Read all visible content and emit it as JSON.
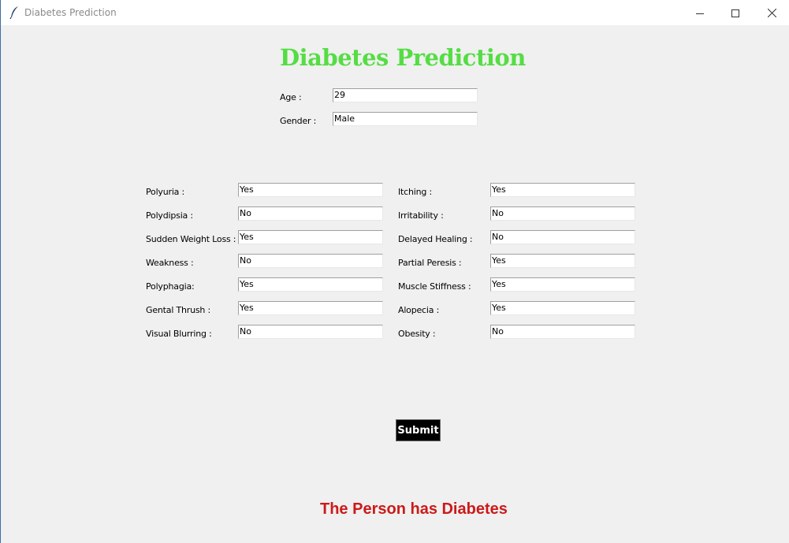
{
  "window": {
    "title": "Diabetes Prediction",
    "icon": "feather-icon",
    "controls": [
      "minimize-icon",
      "maximize-icon",
      "close-icon"
    ]
  },
  "heading": "Diabetes Prediction",
  "demographics": {
    "age_label": "Age :",
    "age_value": "29",
    "gender_label": "Gender :",
    "gender_value": "Male"
  },
  "symptoms_left": [
    {
      "label": "Polyuria :",
      "value": "Yes"
    },
    {
      "label": "Polydipsia :",
      "value": "No"
    },
    {
      "label": "Sudden Weight Loss :",
      "value": "Yes"
    },
    {
      "label": "Weakness :",
      "value": "No"
    },
    {
      "label": "Polyphagia:",
      "value": "Yes"
    },
    {
      "label": "Gental Thrush :",
      "value": "Yes"
    },
    {
      "label": "Visual Blurring :",
      "value": "No"
    }
  ],
  "symptoms_right": [
    {
      "label": "Itching :",
      "value": "Yes"
    },
    {
      "label": "Irritability :",
      "value": "No"
    },
    {
      "label": "Delayed Healing :",
      "value": "No"
    },
    {
      "label": "Partial Peresis :",
      "value": "Yes"
    },
    {
      "label": "Muscle Stiffness :",
      "value": "Yes"
    },
    {
      "label": "Alopecia :",
      "value": "Yes"
    },
    {
      "label": "Obesity :",
      "value": "No"
    }
  ],
  "submit_label": "Submit",
  "result": "The Person has Diabetes",
  "colors": {
    "heading": "#55dd44",
    "result": "#cc1a1a",
    "submit_bg": "#000000",
    "window_bg": "#f0f0f0"
  }
}
